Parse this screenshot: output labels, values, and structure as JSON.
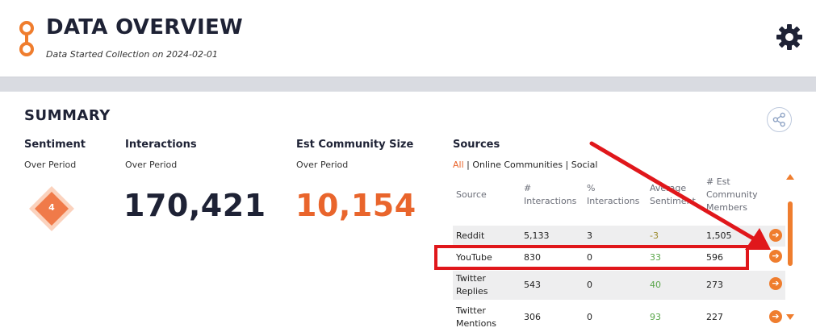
{
  "header": {
    "title": "DATA OVERVIEW",
    "subtitle": "Data Started Collection on 2024-02-01",
    "settings_icon": "gear-icon"
  },
  "summary": {
    "title": "SUMMARY",
    "sentiment": {
      "title": "Sentiment",
      "sub": "Over Period",
      "value": "4"
    },
    "interactions": {
      "title": "Interactions",
      "sub": "Over Period",
      "value": "170,421"
    },
    "community": {
      "title": "Est Community Size",
      "sub": "Over Period",
      "value": "10,154"
    },
    "sources": {
      "title": "Sources",
      "filters": [
        "All",
        "Online Communities",
        "Social"
      ],
      "filter_sep": "|",
      "active_filter": "All",
      "headers": {
        "source": "Source",
        "interactions": [
          "#",
          "Interactions"
        ],
        "pct": [
          "%",
          "Interactions"
        ],
        "sentiment": [
          "Average",
          "Sentiment"
        ],
        "members": [
          "# Est",
          "Community",
          "Members"
        ]
      },
      "rows": [
        {
          "source": [
            "Reddit"
          ],
          "interactions": "5,133",
          "pct": "3",
          "sentiment": "-3",
          "members": "1,505"
        },
        {
          "source": [
            "YouTube"
          ],
          "interactions": "830",
          "pct": "0",
          "sentiment": "33",
          "members": "596"
        },
        {
          "source": [
            "Twitter",
            "Replies"
          ],
          "interactions": "543",
          "pct": "0",
          "sentiment": "40",
          "members": "273"
        },
        {
          "source": [
            "Twitter",
            "Mentions"
          ],
          "interactions": "306",
          "pct": "0",
          "sentiment": "93",
          "members": "227"
        }
      ]
    }
  },
  "colors": {
    "accent": "#ef7d2e",
    "orange_num": "#e9652c",
    "annotation": "#e0171b",
    "positive": "#5aa64a",
    "negative": "#9a8a2a"
  }
}
